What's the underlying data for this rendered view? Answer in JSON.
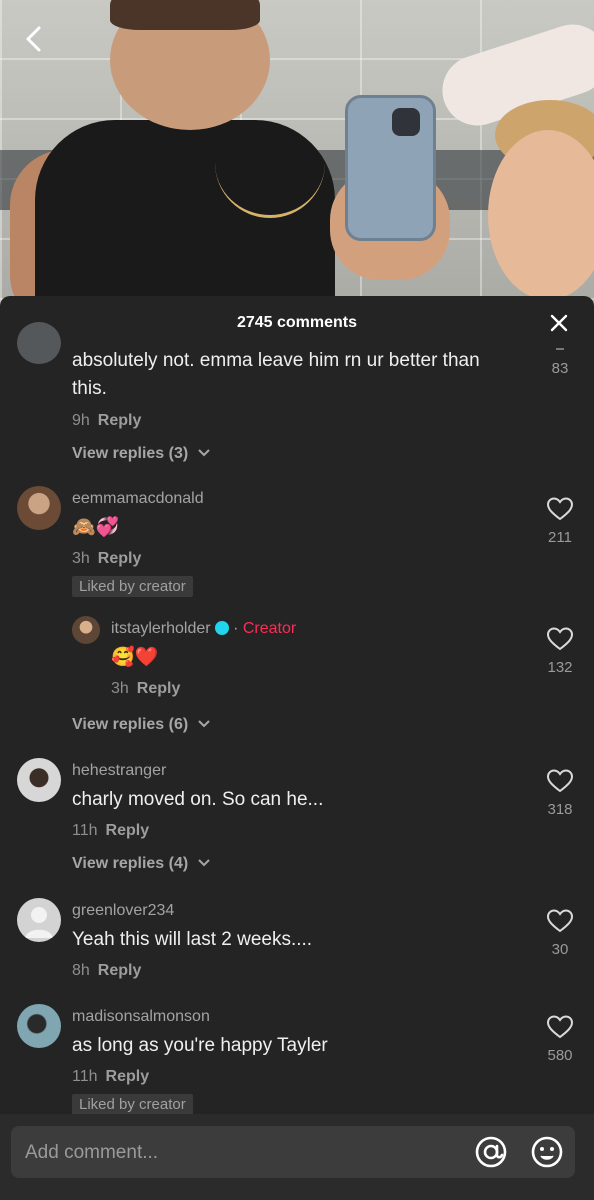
{
  "header": {
    "comment_count": "2745 comments"
  },
  "comments": [
    {
      "username": "",
      "text_line1": "absolutely not. emma leave him rn ur better than",
      "text_line2": "this.",
      "time": "9h",
      "reply_label": "Reply",
      "likes": "83",
      "view_replies": "View replies (3)"
    },
    {
      "username": "eemmamacdonald",
      "text": "🙈💞",
      "time": "3h",
      "reply_label": "Reply",
      "likes": "211",
      "liked_by_creator": "Liked by creator"
    },
    {
      "username": "itstaylerholder",
      "creator_label": "Creator",
      "separator": "·",
      "text": "🥰❤️",
      "time": "3h",
      "reply_label": "Reply",
      "likes": "132",
      "view_replies": "View replies (6)"
    },
    {
      "username": "hehestranger",
      "text": "charly moved on. So can he...",
      "time": "11h",
      "reply_label": "Reply",
      "likes": "318",
      "view_replies": "View replies (4)"
    },
    {
      "username": "greenlover234",
      "text": "Yeah this will last 2 weeks....",
      "time": "8h",
      "reply_label": "Reply",
      "likes": "30"
    },
    {
      "username": "madisonsalmonson",
      "text": "as long as you're happy Tayler",
      "time": "11h",
      "reply_label": "Reply",
      "likes": "580",
      "liked_by_creator": "Liked by creator"
    }
  ],
  "input": {
    "placeholder": "Add comment..."
  },
  "colors": {
    "accent_creator": "#fe2c55",
    "verified": "#20d5ec",
    "sheet_bg": "#242424"
  }
}
